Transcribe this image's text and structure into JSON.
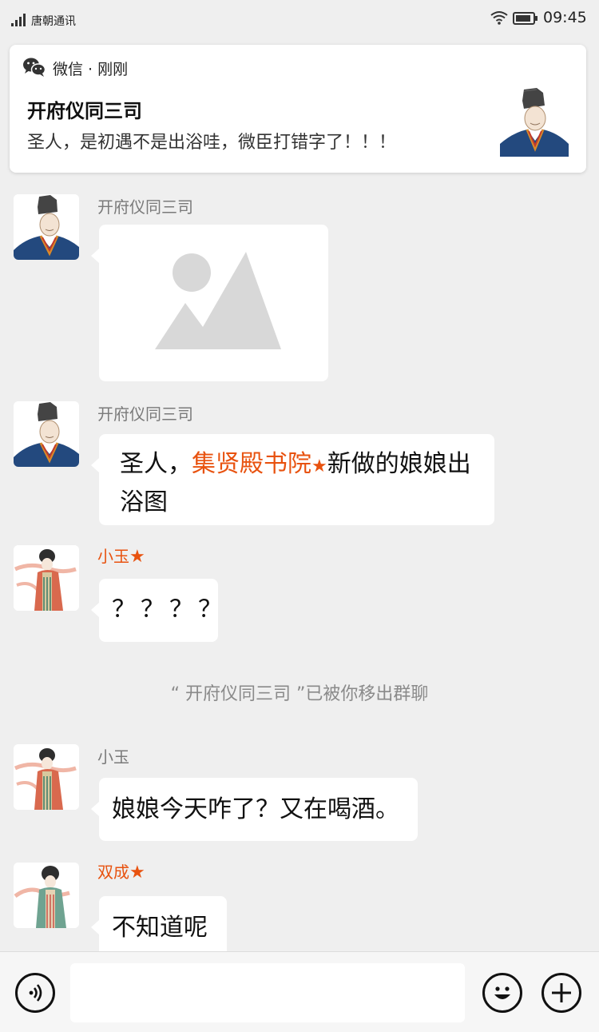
{
  "status_bar": {
    "carrier": "唐朝通讯",
    "time": "09:45"
  },
  "notification": {
    "app_name": "微信 · 刚刚",
    "title": "开府仪同三司",
    "body": "圣人，是初遇不是出浴哇，微臣打错字了！！！"
  },
  "messages": [
    {
      "sender": "开府仪同三司",
      "type": "image-placeholder"
    },
    {
      "sender": "开府仪同三司",
      "text_before": "圣人，",
      "highlight": "集贤殿书院",
      "star": "★",
      "text_after": "新做的娘娘出浴图"
    },
    {
      "sender": "小玉",
      "star": "★",
      "text": "？？？？"
    },
    {
      "sender": "小玉",
      "text": "娘娘今天咋了？又在喝酒。"
    },
    {
      "sender": "双成",
      "star": "★",
      "text": "不知道呢"
    }
  ],
  "system_message": "“ 开府仪同三司 ”已被你移出群聊",
  "input_bar": {
    "voice_icon": "voice-icon",
    "emoji_icon": "emoji-icon",
    "plus_icon": "plus-icon",
    "placeholder": ""
  },
  "colors": {
    "background": "#efefef",
    "accent": "#e8520f",
    "bubble": "#ffffff"
  }
}
